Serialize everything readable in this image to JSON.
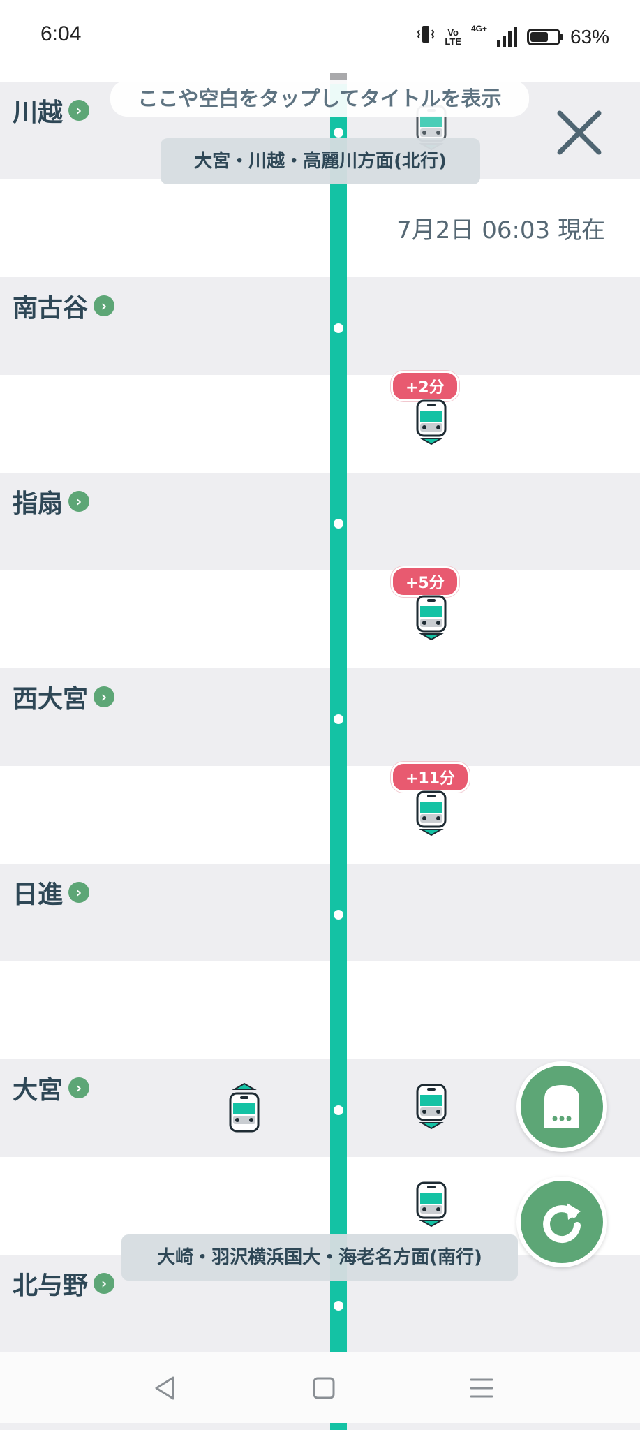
{
  "status_bar": {
    "time": "6:04",
    "network_volte_top": "Vo",
    "network_volte_bottom": "LTE",
    "network_type": "4G+",
    "battery_percent": "63%"
  },
  "header": {
    "tap_hint": "ここや空白をタップしてタイトルを表示",
    "direction_north": "大宮・川越・高麗川方面(北行)",
    "direction_south": "大崎・羽沢横浜国大・海老名方面(南行)",
    "timestamp": "7月2日 06:03 現在"
  },
  "stations": [
    {
      "name": "川越"
    },
    {
      "name": "南古谷"
    },
    {
      "name": "指扇"
    },
    {
      "name": "西大宮"
    },
    {
      "name": "日進"
    },
    {
      "name": "大宮"
    },
    {
      "name": "北与野"
    }
  ],
  "trains": [
    {
      "direction": "southbound",
      "location": "川越",
      "delay": ""
    },
    {
      "direction": "southbound",
      "location": "南古谷-指扇",
      "delay": "+2分"
    },
    {
      "direction": "southbound",
      "location": "指扇-西大宮",
      "delay": "+5分"
    },
    {
      "direction": "southbound",
      "location": "西大宮-日進",
      "delay": "+11分"
    },
    {
      "direction": "northbound",
      "location": "大宮",
      "delay": ""
    },
    {
      "direction": "southbound",
      "location": "大宮",
      "delay": ""
    },
    {
      "direction": "southbound",
      "location": "大宮-北与野",
      "delay": ""
    }
  ],
  "colors": {
    "line": "#14c2a4",
    "station_band": "#eeeef1",
    "delay_badge": "#e85a70",
    "fab": "#5da676",
    "text": "#2e4756"
  },
  "icons": {
    "close": "close-icon",
    "train": "train-icon",
    "refresh": "refresh-icon",
    "station_chevron": "chevron-right-icon"
  }
}
